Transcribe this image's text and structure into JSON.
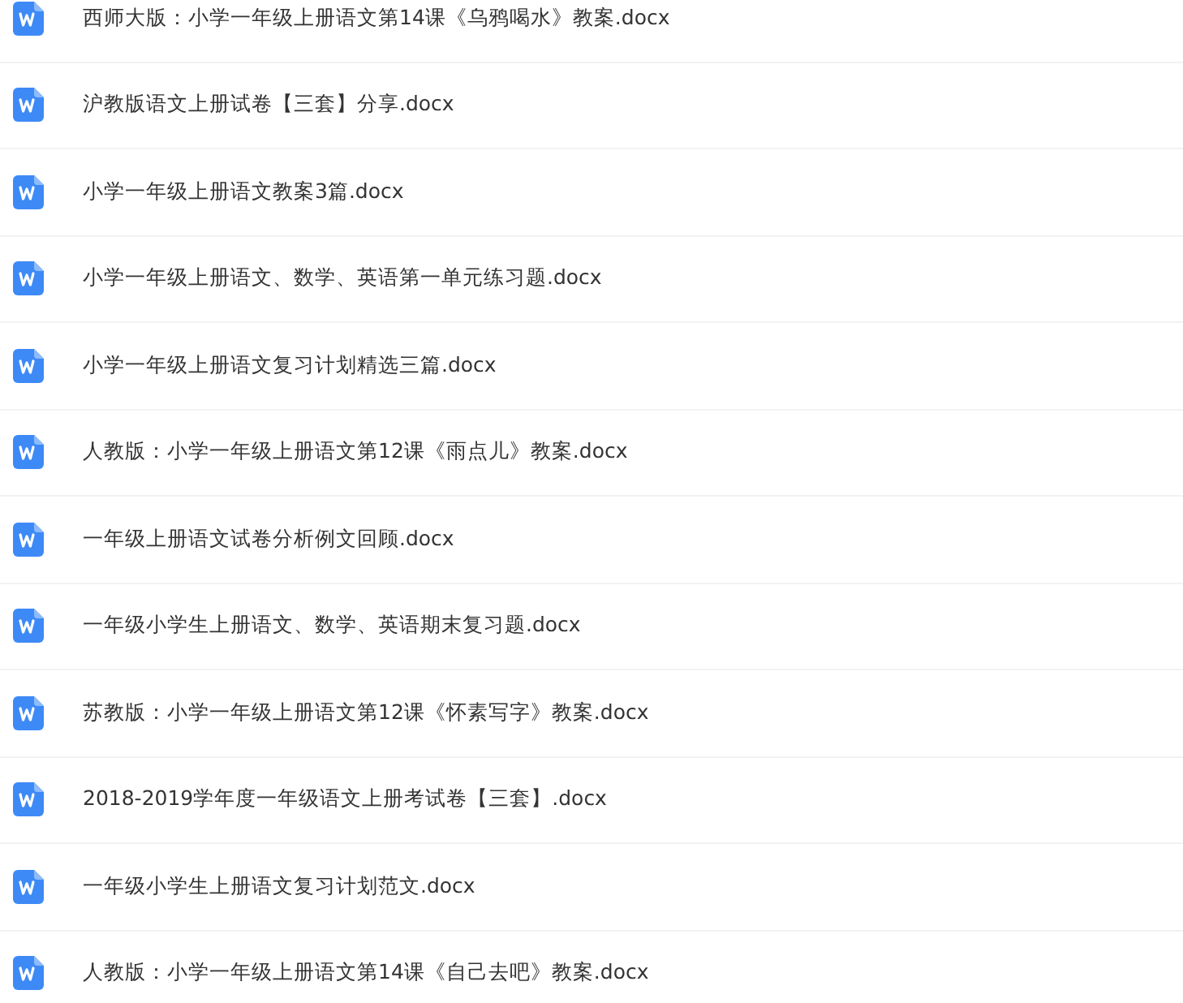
{
  "files": [
    {
      "name": "西师大版：小学一年级上册语文第14课《乌鸦喝水》教案.docx"
    },
    {
      "name": "沪教版语文上册试卷【三套】分享.docx"
    },
    {
      "name": "小学一年级上册语文教案3篇.docx"
    },
    {
      "name": "小学一年级上册语文、数学、英语第一单元练习题.docx"
    },
    {
      "name": "小学一年级上册语文复习计划精选三篇.docx"
    },
    {
      "name": "人教版：小学一年级上册语文第12课《雨点儿》教案.docx"
    },
    {
      "name": "一年级上册语文试卷分析例文回顾.docx"
    },
    {
      "name": "一年级小学生上册语文、数学、英语期末复习题.docx"
    },
    {
      "name": "苏教版：小学一年级上册语文第12课《怀素写字》教案.docx"
    },
    {
      "name": "2018-2019学年度一年级语文上册考试卷【三套】.docx"
    },
    {
      "name": "一年级小学生上册语文复习计划范文.docx"
    },
    {
      "name": "人教版：小学一年级上册语文第14课《自己去吧》教案.docx"
    }
  ]
}
